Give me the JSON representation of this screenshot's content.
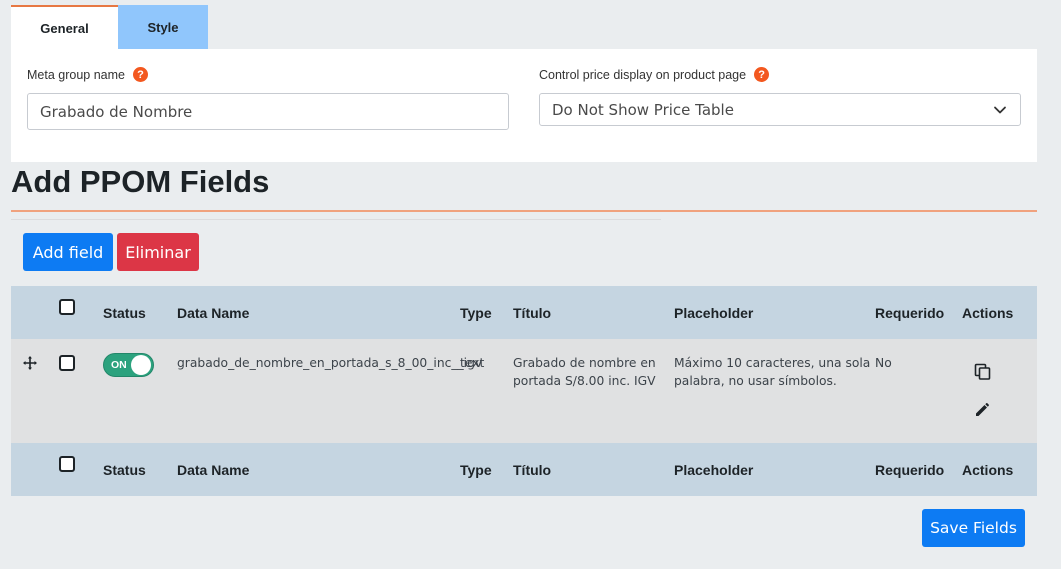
{
  "tabs": [
    {
      "label": "General",
      "active": true
    },
    {
      "label": "Style",
      "active": false
    }
  ],
  "settings": {
    "meta_group_label": "Meta group name",
    "meta_group_value": "Grabado de Nombre",
    "price_display_label": "Control price display on product page",
    "price_display_value": "Do Not Show Price Table",
    "help_glyph": "?"
  },
  "heading": "Add PPOM Fields",
  "buttons": {
    "add_field": "Add field",
    "delete": "Eliminar",
    "save": "Save Fields"
  },
  "table": {
    "columns": [
      "Status",
      "Data Name",
      "Type",
      "Título",
      "Placeholder",
      "Requerido",
      "Actions"
    ],
    "rows": [
      {
        "status": "ON",
        "data_name": "grabado_de_nombre_en_portada_s_8_00_inc__igv",
        "type": "text",
        "titulo_line1": "Grabado de nombre en",
        "titulo_line2": "portada S/8.00 inc. IGV",
        "placeholder_line1": "Máximo 10 caracteres, una sola",
        "placeholder_line2": "palabra, no usar símbolos.",
        "requerido": "No",
        "actions": [
          "copy-icon",
          "edit-icon"
        ]
      }
    ]
  },
  "colors": {
    "accent_orange": "#e77843",
    "help_orange": "#f3581f",
    "primary_blue": "#0d7bf3",
    "danger_red": "#dc3646",
    "toggle_green": "#2ca27e",
    "header_blue": "#c5d5e1"
  }
}
